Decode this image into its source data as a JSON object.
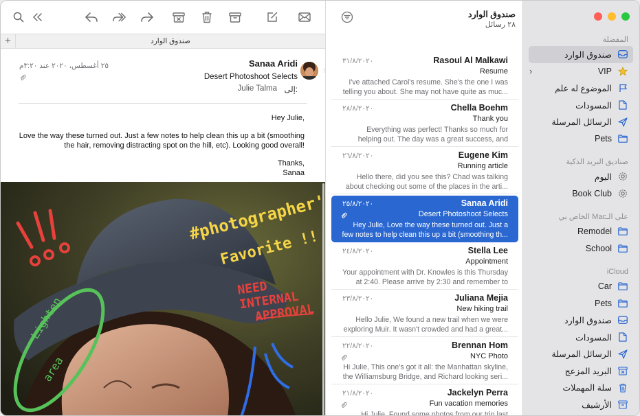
{
  "mailbox": {
    "title": "صندوق الوارد",
    "count": "٢٨ رسائل"
  },
  "tab": {
    "title": "صندوق الوارد",
    "add": "+"
  },
  "sidebar": {
    "favorites": {
      "heading": "المفضلة",
      "items": [
        {
          "label": "صندوق الوارد",
          "icon": "inbox-icon",
          "selected": true
        },
        {
          "label": "VIP",
          "icon": "star-icon"
        },
        {
          "label": "الموضوع له علم",
          "icon": "flag-icon"
        },
        {
          "label": "المسودات",
          "icon": "document-icon"
        },
        {
          "label": "الرسائل المرسلة",
          "icon": "paperplane-icon"
        },
        {
          "label": "Pets",
          "icon": "folder-icon"
        }
      ]
    },
    "smart": {
      "heading": "صناديق البريد الذكية",
      "items": [
        {
          "label": "اليوم",
          "icon": "gear-icon"
        },
        {
          "label": "Book Club",
          "icon": "gear-icon"
        }
      ]
    },
    "onmac": {
      "heading": "على الـMac الخاص بي",
      "items": [
        {
          "label": "Remodel",
          "icon": "folder-icon"
        },
        {
          "label": "School",
          "icon": "folder-icon"
        }
      ]
    },
    "icloud": {
      "heading": "iCloud",
      "items": [
        {
          "label": "Car",
          "icon": "folder-icon"
        },
        {
          "label": "Pets",
          "icon": "folder-icon"
        },
        {
          "label": "صندوق الوارد",
          "icon": "inbox-icon"
        },
        {
          "label": "المسودات",
          "icon": "document-icon"
        },
        {
          "label": "الرسائل المرسلة",
          "icon": "paperplane-icon"
        },
        {
          "label": "البريد المزعج",
          "icon": "junk-icon"
        },
        {
          "label": "سلة المهملات",
          "icon": "trash-icon"
        },
        {
          "label": "الأرشيف",
          "icon": "archive-icon"
        }
      ]
    }
  },
  "messages": [
    {
      "sender": "Rasoul Al Malkawi",
      "date": "٣١/٨/٢٠٢٠",
      "subject": "Resume",
      "preview": "I've attached Carol's resume. She's the one I was telling you about. She may not have quite as muc...",
      "attachment": false
    },
    {
      "sender": "Chella Boehm",
      "date": "٢٨/٨/٢٠٢٠",
      "subject": "Thank you",
      "preview": "Everything was perfect! Thanks so much for helping out. The day was a great success, and we...",
      "attachment": false
    },
    {
      "sender": "Eugene Kim",
      "date": "٢٦/٨/٢٠٢٠",
      "subject": "Running article",
      "preview": "Hello there, did you see this? Chad was talking about checking out some of the places in the arti...",
      "attachment": false
    },
    {
      "sender": "Sanaa Aridi",
      "date": "٢٥/٨/٢٠٢٠",
      "subject": "Desert Photoshoot Selects",
      "preview": "Hey Julie, Love the way these turned out. Just a few notes to help clean this up a bit (smoothing th...",
      "attachment": true,
      "selected": true
    },
    {
      "sender": "Stella Lee",
      "date": "٢٤/٨/٢٠٢٠",
      "subject": "Appointment",
      "preview": "Your appointment with Dr. Knowles is this Thursday at 2:40. Please arrive by 2:30 and remember to br...",
      "attachment": false
    },
    {
      "sender": "Juliana Mejia",
      "date": "٢٣/٨/٢٠٢٠",
      "subject": "New hiking trail",
      "preview": "Hello Julie, We found a new trail when we were exploring Muir. It wasn't crowded and had a great...",
      "attachment": false
    },
    {
      "sender": "Brennan Hom",
      "date": "٢٢/٨/٢٠٢٠",
      "subject": "NYC Photo",
      "preview": "Hi Julie, This one's got it all: the Manhattan skyline, the Williamsburg Bridge, and Richard looking seri...",
      "attachment": true
    },
    {
      "sender": "Jackelyn Perra",
      "date": "٢١/٨/٢٠٢٠",
      "subject": "Fun vacation memories",
      "preview": "Hi Julie, Found some photos from our trip last year...",
      "attachment": true
    }
  ],
  "reader": {
    "from": "Sanaa Aridi",
    "subject": "Desert Photoshoot Selects",
    "to_label": "إلى:",
    "to_value": "Julie Talma",
    "date": "٢٥ أغسطس، ٢٠٢٠ عند ٣:٢٠م",
    "body": {
      "greeting": "Hey Julie,",
      "text": "Love the way these turned out. Just a few notes to help clean this up a bit (smoothing the hair, removing distracting spot on the hill, etc). Looking good overall!",
      "signoff1": "Thanks,",
      "signoff2": "Sanaa"
    },
    "markup": {
      "line1": "#photographer's",
      "line2": "Favorite !!",
      "need1": "NEED",
      "need2": "INTERNAL",
      "need3": "APPROVAL",
      "lighten1": "Lighten",
      "lighten2": "area"
    }
  },
  "colors": {
    "accent": "#2a67d1",
    "sidebar_bg": "#e4e4e6",
    "markup_yellow": "#f5d547",
    "markup_red": "#e8413c",
    "markup_green": "#58c25a",
    "markup_blue": "#2f6ee6"
  }
}
